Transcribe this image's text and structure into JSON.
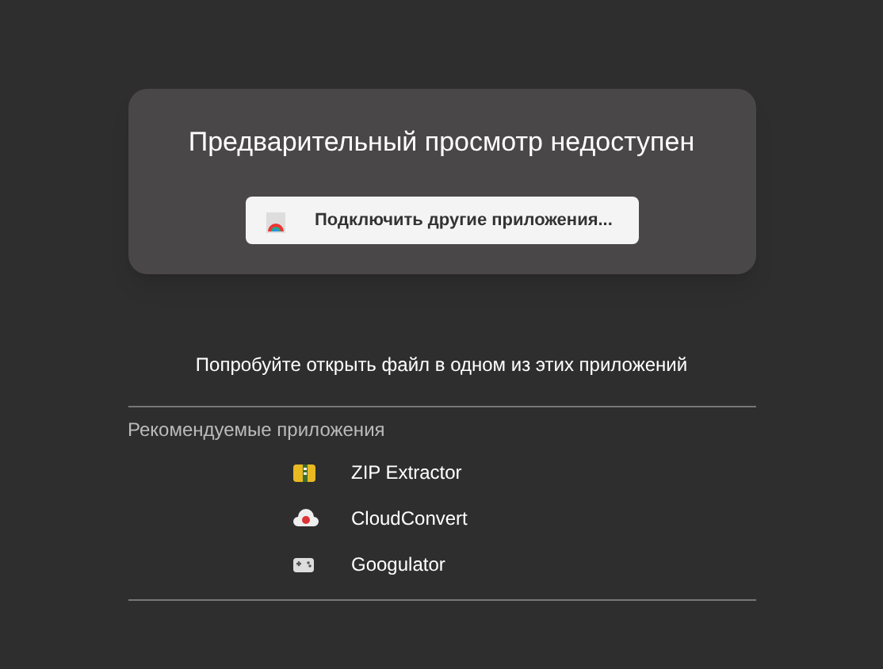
{
  "preview": {
    "title": "Предварительный просмотр недоступен",
    "connect_button": "Подключить другие приложения..."
  },
  "suggestion": "Попробуйте открыть файл в одном из этих приложений",
  "recommended": {
    "heading": "Рекомендуемые приложения",
    "apps": [
      {
        "name": "ZIP Extractor",
        "kind": "zip"
      },
      {
        "name": "CloudConvert",
        "kind": "cloud"
      },
      {
        "name": "Googulator",
        "kind": "gamepad"
      }
    ]
  }
}
